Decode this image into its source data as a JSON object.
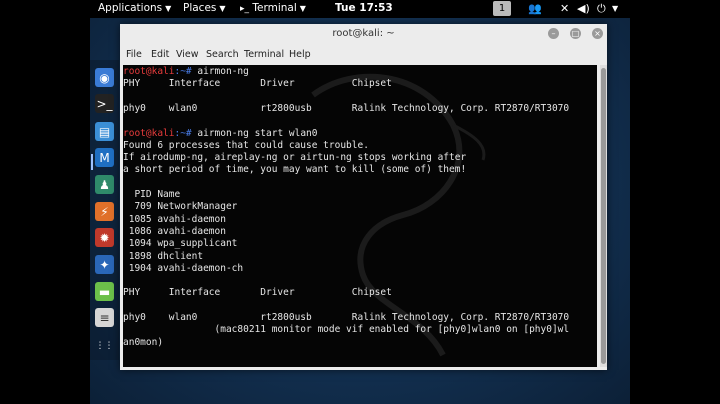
{
  "topbar": {
    "applications": "Applications",
    "places": "Places",
    "terminal": "Terminal",
    "clock": "Tue 17:53",
    "workspace": "1"
  },
  "window": {
    "title": "root@kali: ~",
    "min_btn": "–",
    "max_btn": "□",
    "close_btn": "×"
  },
  "menu": [
    "File",
    "Edit",
    "View",
    "Search",
    "Terminal",
    "Help"
  ],
  "terminal": {
    "lines": [
      {
        "prompt": "root@kali",
        "path": ":~#",
        "text": " airmon-ng"
      },
      {
        "text": "PHY     Interface       Driver          Chipset"
      },
      {
        "text": ""
      },
      {
        "text": "phy0    wlan0           rt2800usb       Ralink Technology, Corp. RT2870/RT3070"
      },
      {
        "text": ""
      },
      {
        "prompt": "root@kali",
        "path": ":~#",
        "text": " airmon-ng start wlan0"
      },
      {
        "text": "Found 6 processes that could cause trouble."
      },
      {
        "text": "If airodump-ng, aireplay-ng or airtun-ng stops working after"
      },
      {
        "text": "a short period of time, you may want to kill (some of) them!"
      },
      {
        "text": ""
      },
      {
        "text": "  PID Name"
      },
      {
        "text": "  709 NetworkManager"
      },
      {
        "text": " 1085 avahi-daemon"
      },
      {
        "text": " 1086 avahi-daemon"
      },
      {
        "text": " 1094 wpa_supplicant"
      },
      {
        "text": " 1898 dhclient"
      },
      {
        "text": " 1904 avahi-daemon-ch"
      },
      {
        "text": ""
      },
      {
        "text": "PHY     Interface       Driver          Chipset"
      },
      {
        "text": ""
      },
      {
        "text": "phy0    wlan0           rt2800usb       Ralink Technology, Corp. RT2870/RT3070"
      },
      {
        "text": "                (mac80211 monitor mode vif enabled for [phy0]wlan0 on [phy0]wl"
      },
      {
        "text": "an0mon)"
      }
    ]
  },
  "dock": [
    {
      "icon": "browser-icon",
      "color": "#3a7bd5"
    },
    {
      "icon": "terminal-icon",
      "color": "#222222"
    },
    {
      "icon": "files-icon",
      "color": "#3b8fd6"
    },
    {
      "icon": "metasploit-icon",
      "color": "#1f6fc2"
    },
    {
      "icon": "armitage-icon",
      "color": "#2f8a6a"
    },
    {
      "icon": "burpsuite-icon",
      "color": "#e0702a"
    },
    {
      "icon": "maltego-icon",
      "color": "#c0392b"
    },
    {
      "icon": "tools-icon",
      "color": "#2a67b8"
    },
    {
      "icon": "leafpad-icon",
      "color": "#6cc04a"
    },
    {
      "icon": "notes-icon",
      "color": "#d6d6d6"
    },
    {
      "icon": "show-apps-icon",
      "color": "#2c3e50"
    }
  ]
}
